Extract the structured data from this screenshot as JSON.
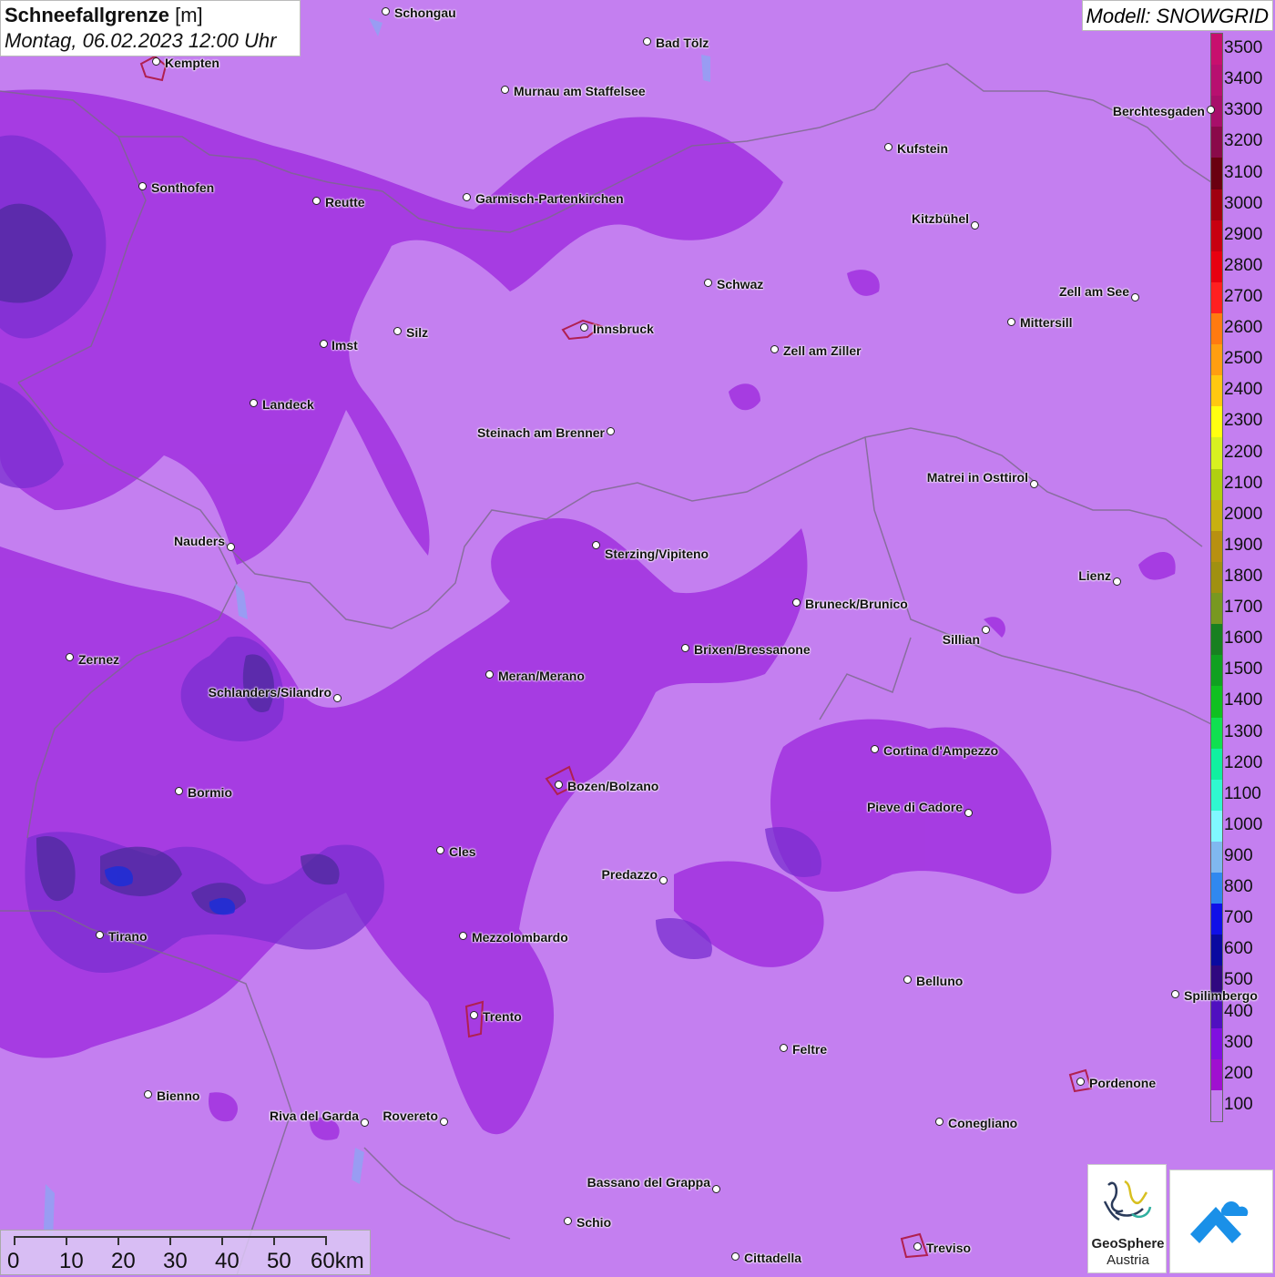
{
  "title": {
    "main": "Schneefallgrenze",
    "unit": "[m]",
    "datetime": "Montag, 06.02.2023 12:00 Uhr"
  },
  "model": "Modell: SNOWGRID",
  "legend": {
    "values": [
      3500,
      3400,
      3300,
      3200,
      3100,
      3000,
      2900,
      2800,
      2700,
      2600,
      2500,
      2400,
      2300,
      2200,
      2100,
      2000,
      1900,
      1800,
      1700,
      1600,
      1500,
      1400,
      1300,
      1200,
      1100,
      1000,
      900,
      800,
      700,
      600,
      500,
      400,
      300,
      200,
      100
    ],
    "colors": [
      "#c8106e",
      "#b81070",
      "#a80f6a",
      "#8a0a4a",
      "#6a0010",
      "#a00010",
      "#c80010",
      "#e80010",
      "#ff2020",
      "#ff7a10",
      "#ff9e10",
      "#ffc810",
      "#ffff10",
      "#d8f020",
      "#b0d010",
      "#c8b010",
      "#b89010",
      "#a09010",
      "#789820",
      "#188020",
      "#10a020",
      "#10c020",
      "#10e050",
      "#10f0a0",
      "#30f8d0",
      "#80f8ff",
      "#80b8f0",
      "#3088f0",
      "#1010e8",
      "#0a0aa0",
      "#300880",
      "#5010c0",
      "#8010e0",
      "#a010d0",
      "#c47ff0"
    ]
  },
  "cities": [
    {
      "name": "Schongau"
    },
    {
      "name": "Bad Tölz"
    },
    {
      "name": "Kempten"
    },
    {
      "name": "Murnau am Staffelsee"
    },
    {
      "name": "Berchtesgaden"
    },
    {
      "name": "Kufstein"
    },
    {
      "name": "Sonthofen"
    },
    {
      "name": "Reutte"
    },
    {
      "name": "Garmisch-Partenkirchen"
    },
    {
      "name": "Kitzbühel"
    },
    {
      "name": "Schwaz"
    },
    {
      "name": "Zell am See"
    },
    {
      "name": "Mittersill"
    },
    {
      "name": "Innsbruck"
    },
    {
      "name": "Imst"
    },
    {
      "name": "Silz"
    },
    {
      "name": "Zell am Ziller"
    },
    {
      "name": "Landeck"
    },
    {
      "name": "Steinach am Brenner"
    },
    {
      "name": "Matrei in Osttirol"
    },
    {
      "name": "Nauders"
    },
    {
      "name": "Sterzing/Vipiteno"
    },
    {
      "name": "Lienz"
    },
    {
      "name": "Bruneck/Brunico"
    },
    {
      "name": "Sillian"
    },
    {
      "name": "Zernez"
    },
    {
      "name": "Brixen/Bressanone"
    },
    {
      "name": "Meran/Merano"
    },
    {
      "name": "Schlanders/Silandro"
    },
    {
      "name": "Cortina d'Ampezzo"
    },
    {
      "name": "Bozen/Bolzano"
    },
    {
      "name": "Bormio"
    },
    {
      "name": "Pieve di Cadore"
    },
    {
      "name": "Cles"
    },
    {
      "name": "Predazzo"
    },
    {
      "name": "Tirano"
    },
    {
      "name": "Mezzolombardo"
    },
    {
      "name": "Belluno"
    },
    {
      "name": "Spilimbergo"
    },
    {
      "name": "Trento"
    },
    {
      "name": "Feltre"
    },
    {
      "name": "Pordenone"
    },
    {
      "name": "Bienno"
    },
    {
      "name": "Riva del Garda"
    },
    {
      "name": "Rovereto"
    },
    {
      "name": "Conegliano"
    },
    {
      "name": "Bassano del Grappa"
    },
    {
      "name": "Schio"
    },
    {
      "name": "Treviso"
    },
    {
      "name": "Cittadella"
    }
  ],
  "scale": {
    "labels": [
      "0",
      "10",
      "20",
      "30",
      "40",
      "50",
      "60km"
    ]
  },
  "logos": {
    "geosphere_line1": "GeoSphere",
    "geosphere_line2": "Austria"
  }
}
